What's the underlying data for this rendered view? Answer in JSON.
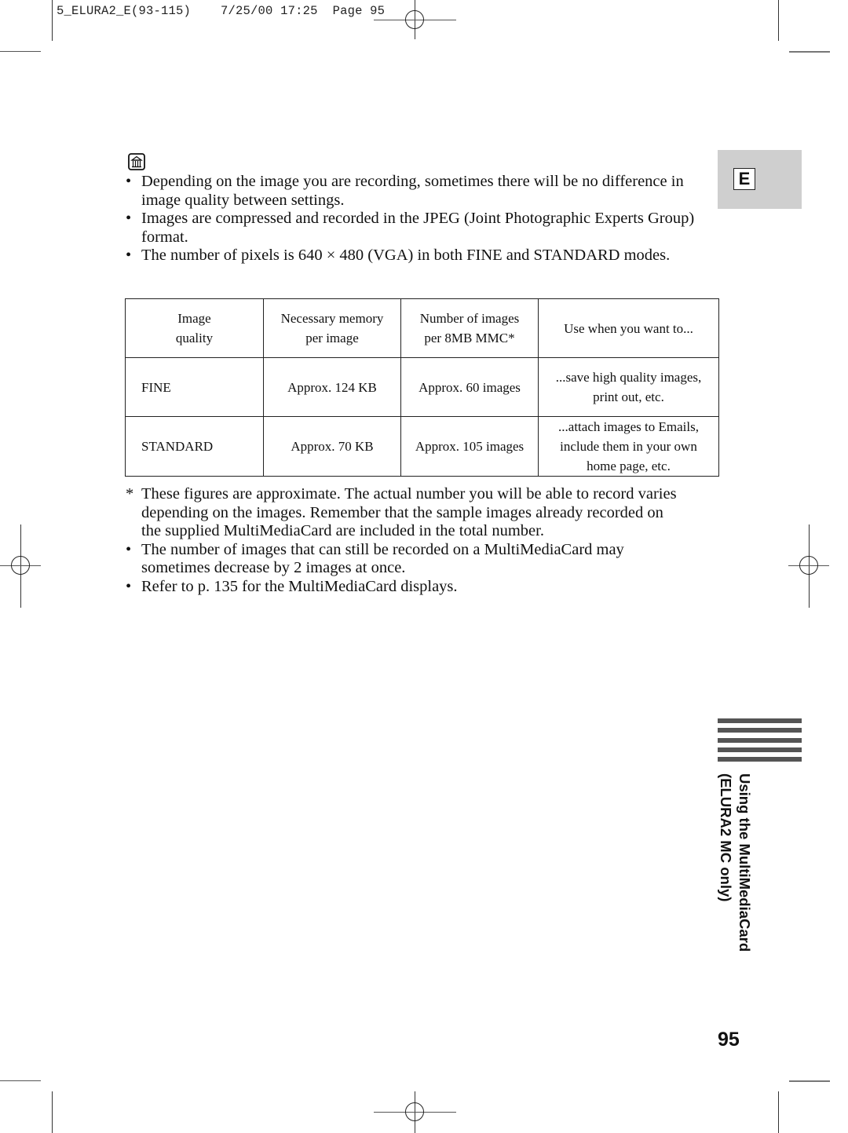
{
  "slug": {
    "file": "5_ELURA2_E(93-115)",
    "date": "7/25/00",
    "time": "17:25",
    "page_label": "Page",
    "page_number": "95"
  },
  "notes_icon": "memo-notes-icon",
  "bullets_top": [
    {
      "mark": "•",
      "text": "Depending on the image you are recording, sometimes there will be no difference in image quality between settings."
    },
    {
      "mark": "•",
      "text": "Images are compressed and recorded in the JPEG (Joint Photographic Experts Group) format."
    },
    {
      "mark": "•",
      "text": "The number of pixels is 640 × 480 (VGA) in both FINE and STANDARD modes."
    }
  ],
  "table": {
    "headers": [
      [
        "Image",
        "quality"
      ],
      [
        "Necessary memory",
        "per image"
      ],
      [
        "Number of images",
        "per 8MB MMC*"
      ],
      [
        "Use when you want to..."
      ]
    ],
    "rows": [
      {
        "quality": "FINE",
        "memory": "Approx. 124 KB",
        "count": "Approx. 60 images",
        "use": [
          "...save high quality images,",
          "print out, etc."
        ]
      },
      {
        "quality": "STANDARD",
        "memory": "Approx. 70 KB",
        "count": "Approx. 105 images",
        "use": [
          "...attach images to Emails,",
          "include them in your own",
          "home page, etc."
        ]
      }
    ]
  },
  "bullets_bottom": [
    {
      "mark": "*",
      "text": "These figures are approximate. The actual number you will be able to record varies depending on the images. Remember that the sample images already recorded on the supplied MultiMediaCard are included in the total number."
    },
    {
      "mark": "•",
      "text": "The number of images that can still be recorded on a MultiMediaCard may sometimes decrease by 2 images at once."
    },
    {
      "mark": "•",
      "text": "Refer to p. 135 for the MultiMediaCard displays."
    }
  ],
  "side_tab": {
    "letter": "E",
    "section_line1": "Using the MultiMediaCard",
    "section_line2": "(ELURA2 MC only)"
  },
  "page_number": "95"
}
